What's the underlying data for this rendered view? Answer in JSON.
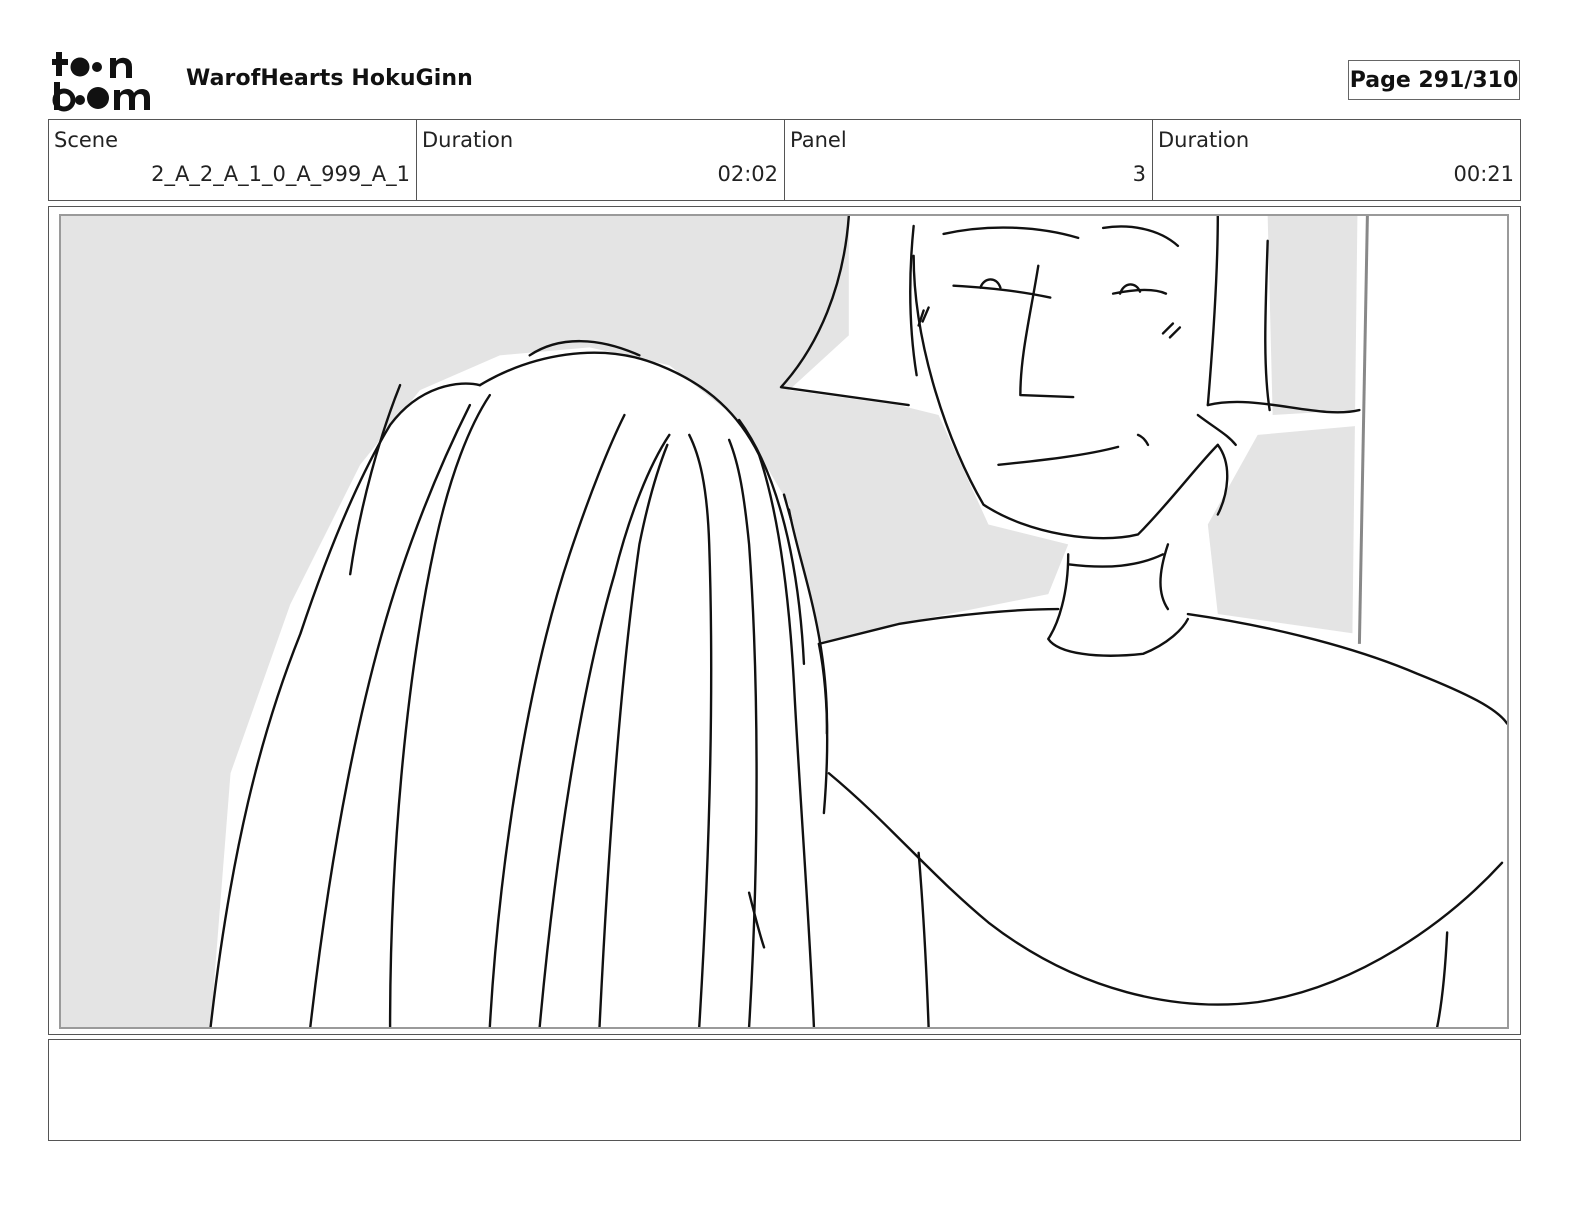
{
  "header": {
    "logo_text": "toonboom",
    "project_title": "WarofHearts HokuGinn",
    "page_label": "Page 291/310"
  },
  "info": {
    "scene_label": "Scene",
    "scene_value": "2_A_2_A_1_0_A_999_A_1",
    "scene_duration_label": "Duration",
    "scene_duration_value": "02:02",
    "panel_label": "Panel",
    "panel_value": "3",
    "panel_duration_label": "Duration",
    "panel_duration_value": "00:21"
  },
  "notes": {
    "text": ""
  }
}
